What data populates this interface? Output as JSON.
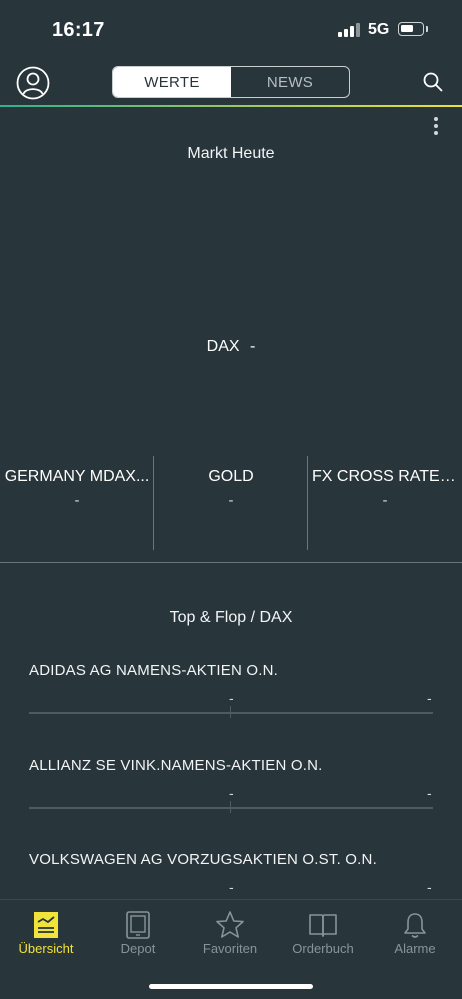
{
  "status_bar": {
    "time": "16:17",
    "network": "5G"
  },
  "header": {
    "tabs": [
      {
        "label": "WERTE",
        "active": true
      },
      {
        "label": "NEWS",
        "active": false
      }
    ],
    "accent_colors": [
      "#2fb28c",
      "#e9e33a"
    ]
  },
  "market_today": {
    "title": "Markt Heute",
    "main_index": {
      "name": "DAX",
      "value": "-"
    },
    "indices": [
      {
        "name": "GERMANY MDAX...",
        "value": "-"
      },
      {
        "name": "GOLD",
        "value": "-"
      },
      {
        "name": "FX CROSS RATE E...",
        "value": "-"
      }
    ]
  },
  "top_flop": {
    "title": "Top & Flop / DAX",
    "items": [
      {
        "name": "ADIDAS AG NAMENS-AKTIEN O.N.",
        "value_center": "-",
        "value_right": "-"
      },
      {
        "name": "ALLIANZ SE VINK.NAMENS-AKTIEN O.N.",
        "value_center": "-",
        "value_right": "-"
      },
      {
        "name": "VOLKSWAGEN AG VORZUGSAKTIEN O.ST. O.N.",
        "value_center": "-",
        "value_right": "-"
      }
    ]
  },
  "tabbar": {
    "items": [
      {
        "label": "Übersicht",
        "icon": "overview-chart-icon",
        "active": true
      },
      {
        "label": "Depot",
        "icon": "tablet-icon",
        "active": false
      },
      {
        "label": "Favoriten",
        "icon": "star-icon",
        "active": false
      },
      {
        "label": "Orderbuch",
        "icon": "book-icon",
        "active": false
      },
      {
        "label": "Alarme",
        "icon": "bell-icon",
        "active": false
      }
    ],
    "active_color": "#f2e33a"
  }
}
